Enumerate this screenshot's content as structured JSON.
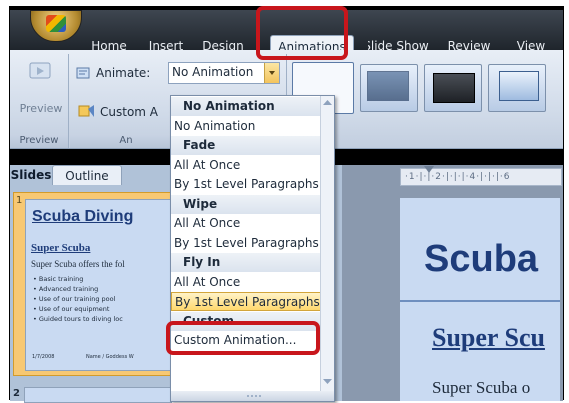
{
  "tabs": [
    {
      "label": "Home",
      "active": false
    },
    {
      "label": "Insert",
      "active": false
    },
    {
      "label": "Design",
      "active": false
    },
    {
      "label": "Animations",
      "active": true
    },
    {
      "label": "Slide Show",
      "active": false
    },
    {
      "label": "Review",
      "active": false
    },
    {
      "label": "View",
      "active": false
    }
  ],
  "ribbon": {
    "preview_label": "Preview",
    "preview_group_label": "Preview",
    "animate_label": "Animate:",
    "animate_value": "No Animation",
    "custom_animation_label": "Custom A",
    "animations_group_label": "An"
  },
  "pane": {
    "tab_slides": "Slides",
    "tab_outline": "Outline",
    "slide_number": "1",
    "slide2_number": "2",
    "thumb_title": "Scuba Diving",
    "thumb_subtitle": "Super Scuba",
    "thumb_body": "Super Scuba offers the fol",
    "bullets": [
      "• Basic training",
      "• Advanced training",
      "• Use of our training pool",
      "• Use of our equipment",
      "• Guided tours to diving loc"
    ],
    "footer_left": "1/7/2008",
    "footer_mid": "Name / Goddess W"
  },
  "editor": {
    "ruler": "·1·|·|·2·|·|·|·4·|·|·|·6",
    "slide_title": "Scuba",
    "slide_subtitle": "Super Scu",
    "slide_body": "Super Scuba o"
  },
  "dropdown": {
    "items": [
      {
        "label": "No Animation",
        "kind": "header"
      },
      {
        "label": "No Animation",
        "kind": "item"
      },
      {
        "label": "Fade",
        "kind": "header"
      },
      {
        "label": "All At Once",
        "kind": "item"
      },
      {
        "label": "By 1st Level Paragraphs",
        "kind": "item"
      },
      {
        "label": "Wipe",
        "kind": "header"
      },
      {
        "label": "All At Once",
        "kind": "item"
      },
      {
        "label": "By 1st Level Paragraphs",
        "kind": "item"
      },
      {
        "label": "Fly In",
        "kind": "header"
      },
      {
        "label": "All At Once",
        "kind": "item"
      },
      {
        "label": "By 1st Level Paragraphs",
        "kind": "highlighted"
      },
      {
        "label": "Custom",
        "kind": "header"
      },
      {
        "label": "Custom Animation...",
        "kind": "item"
      }
    ]
  },
  "colors": {
    "callout": "#c8161c",
    "highlight": "#ffd86e",
    "ribbon": "#d2dcea"
  }
}
